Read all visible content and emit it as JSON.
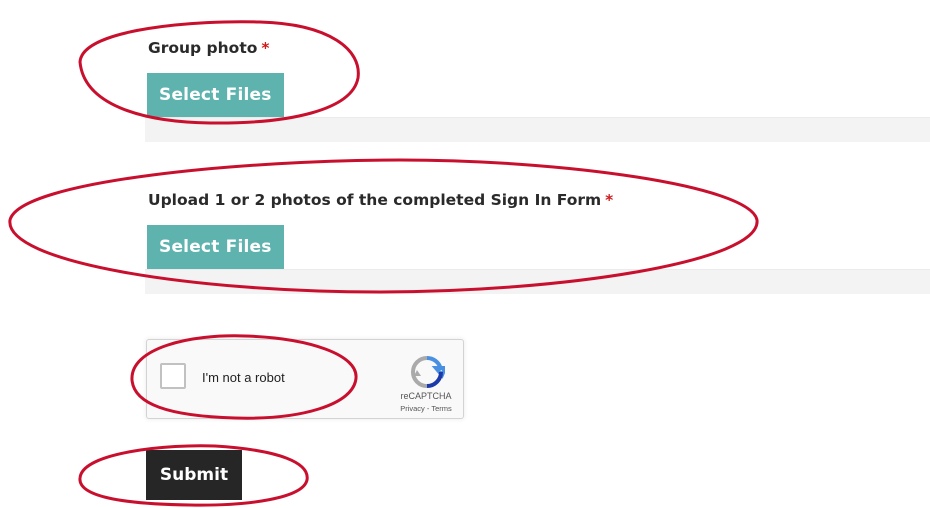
{
  "group_photo": {
    "label": "Group photo",
    "required_mark": "*",
    "button_label": "Select Files"
  },
  "sign_in_form": {
    "label": "Upload 1 or 2 photos of the completed Sign In Form",
    "required_mark": "*",
    "button_label": "Select Files"
  },
  "recaptcha": {
    "checkbox_label": "I'm not a robot",
    "brand": "reCAPTCHA",
    "privacy_terms": "Privacy - Terms",
    "icon": "recaptcha-logo-icon"
  },
  "submit": {
    "label": "Submit"
  },
  "colors": {
    "select_button": "#5fb3ae",
    "submit_button": "#262626",
    "required": "#d11a1a",
    "annotation": "#c8102e"
  }
}
